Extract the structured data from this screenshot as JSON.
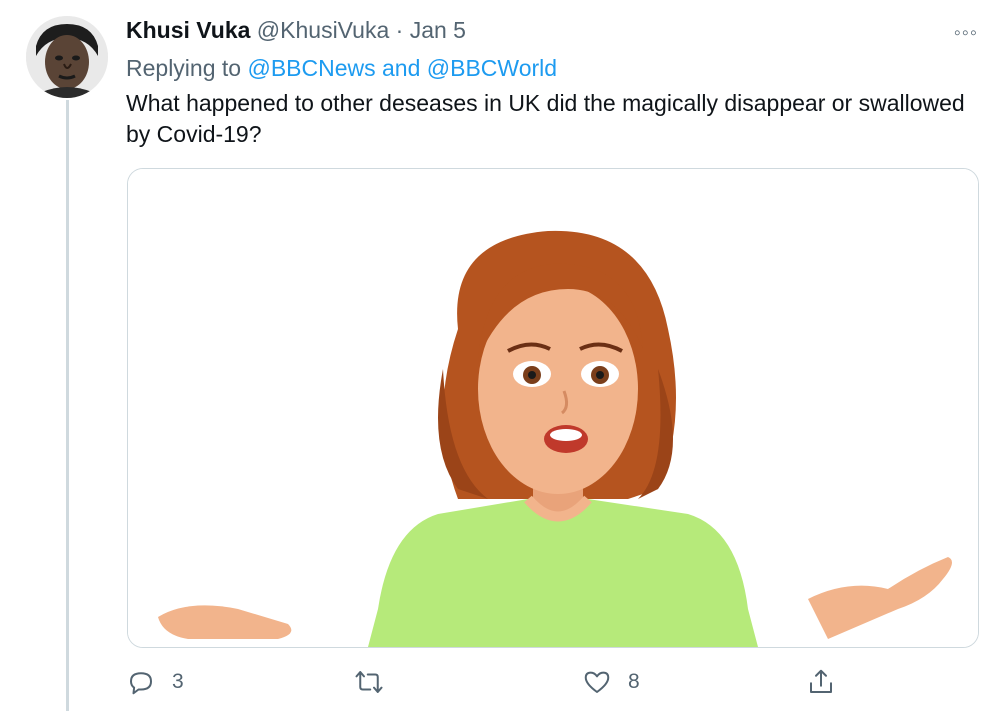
{
  "tweet": {
    "author_name": "Khusi Vuka",
    "handle": "@KhusiVuka",
    "separator": "·",
    "date": "Jan 5",
    "replying_prefix": "Replying to",
    "replying_to": [
      "@BBCNews",
      "@BBCWorld"
    ],
    "replying_joiner": "and",
    "text": "What happened to other deseases in UK did the magically disappear or swallowed by Covid-19?",
    "more_icon": "more-options-icon"
  },
  "actions": {
    "reply": {
      "icon": "reply-icon",
      "count": "3"
    },
    "retweet": {
      "icon": "retweet-icon",
      "count": ""
    },
    "like": {
      "icon": "heart-icon",
      "count": "8"
    },
    "share": {
      "icon": "share-icon"
    }
  },
  "colors": {
    "accent": "#1d9bf0",
    "text_secondary": "#536471",
    "hair": "#b5541f",
    "skin": "#f2b48c",
    "shirt": "#b6ea7a"
  }
}
